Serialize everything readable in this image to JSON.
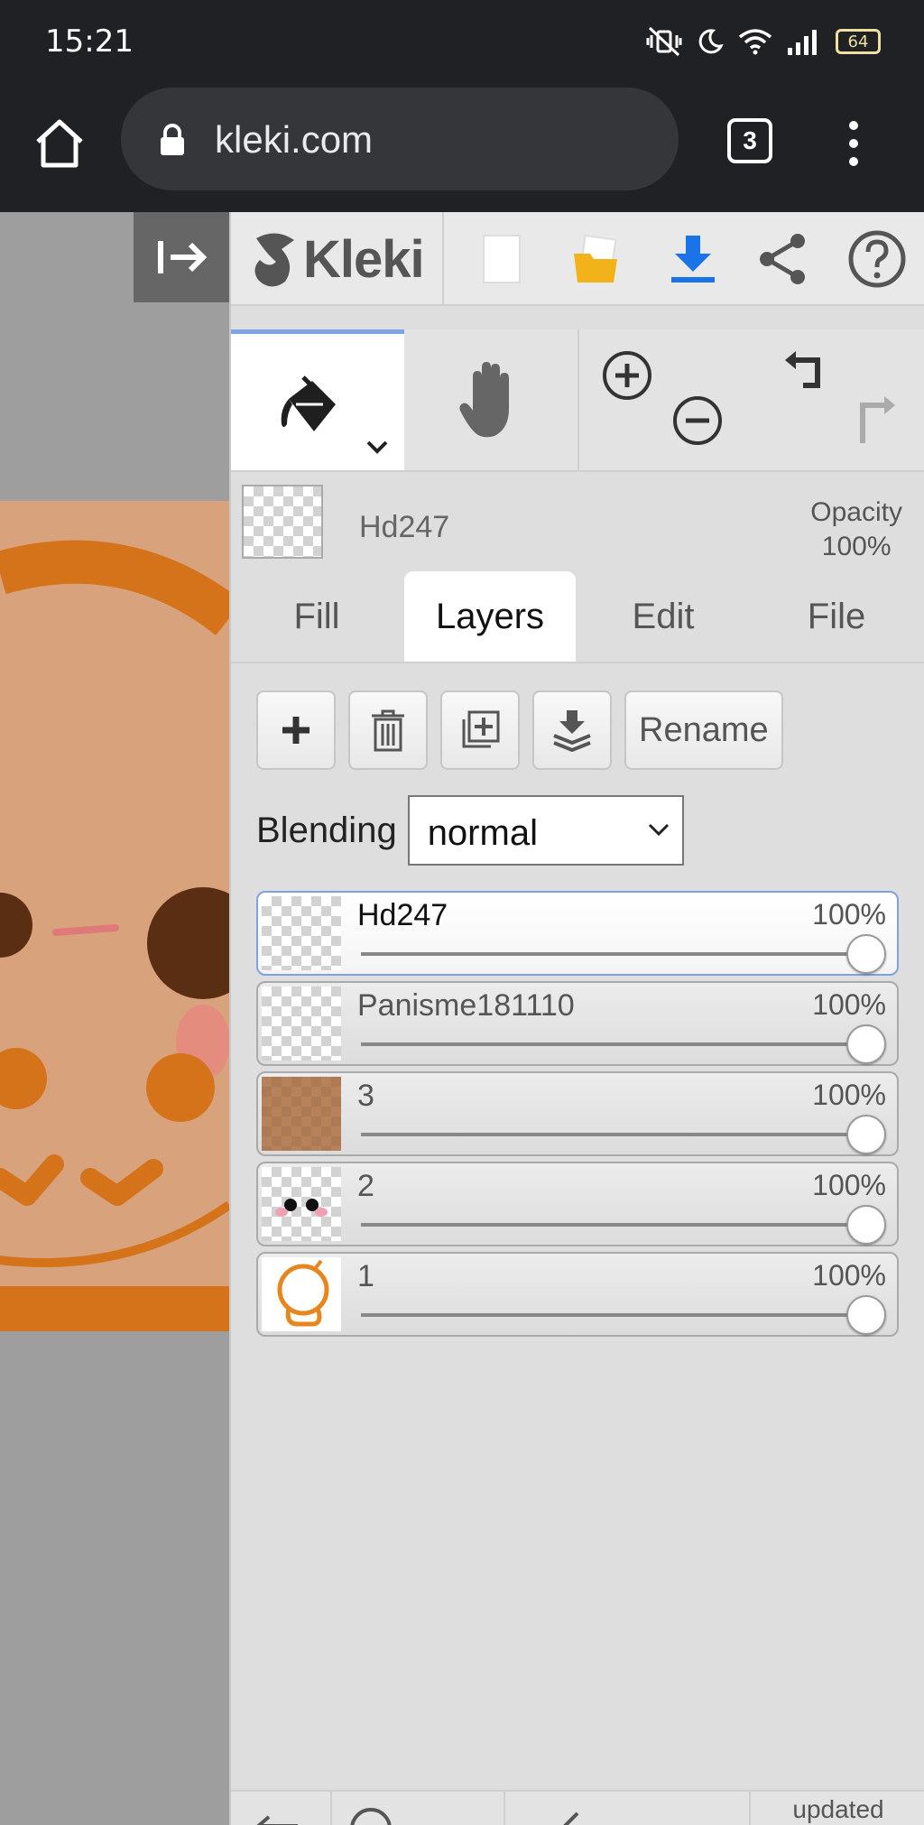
{
  "status_bar": {
    "time": "15:21",
    "battery": "64",
    "icons": [
      "vibrate-off-icon",
      "moon-icon",
      "wifi-icon",
      "signal-icon",
      "battery-icon"
    ]
  },
  "browser": {
    "url": "kleki.com",
    "tab_count": "3"
  },
  "app": {
    "logo_text": "Kleki",
    "header_icons": [
      "new-image-icon",
      "open-folder-icon",
      "download-icon",
      "share-icon",
      "help-icon"
    ],
    "current_layer_name": "Hd247",
    "opacity_label": "Opacity",
    "opacity_value": "100%",
    "tabs": [
      {
        "label": "Fill",
        "active": false
      },
      {
        "label": "Layers",
        "active": true
      },
      {
        "label": "Edit",
        "active": false
      },
      {
        "label": "File",
        "active": false
      }
    ],
    "actions": {
      "rename_label": "Rename"
    },
    "blending": {
      "label": "Blending",
      "value": "normal"
    },
    "layers": [
      {
        "name": "Hd247",
        "opacity": "100%",
        "active": true,
        "opacity_fraction": 1.0
      },
      {
        "name": "Panisme181110",
        "opacity": "100%",
        "active": false,
        "opacity_fraction": 1.0
      },
      {
        "name": "3",
        "opacity": "100%",
        "active": false,
        "opacity_fraction": 1.0
      },
      {
        "name": "2",
        "opacity": "100%",
        "active": false,
        "opacity_fraction": 1.0
      },
      {
        "name": "1",
        "opacity": "100%",
        "active": false,
        "opacity_fraction": 1.0
      }
    ],
    "footer": {
      "updated_label": "updated"
    }
  },
  "colors": {
    "accent": "#7ea3e0",
    "download_blue": "#1a73e8",
    "folder_yellow": "#f2b21a",
    "art_orange": "#d4731a",
    "art_skin": "#d8a27c"
  }
}
